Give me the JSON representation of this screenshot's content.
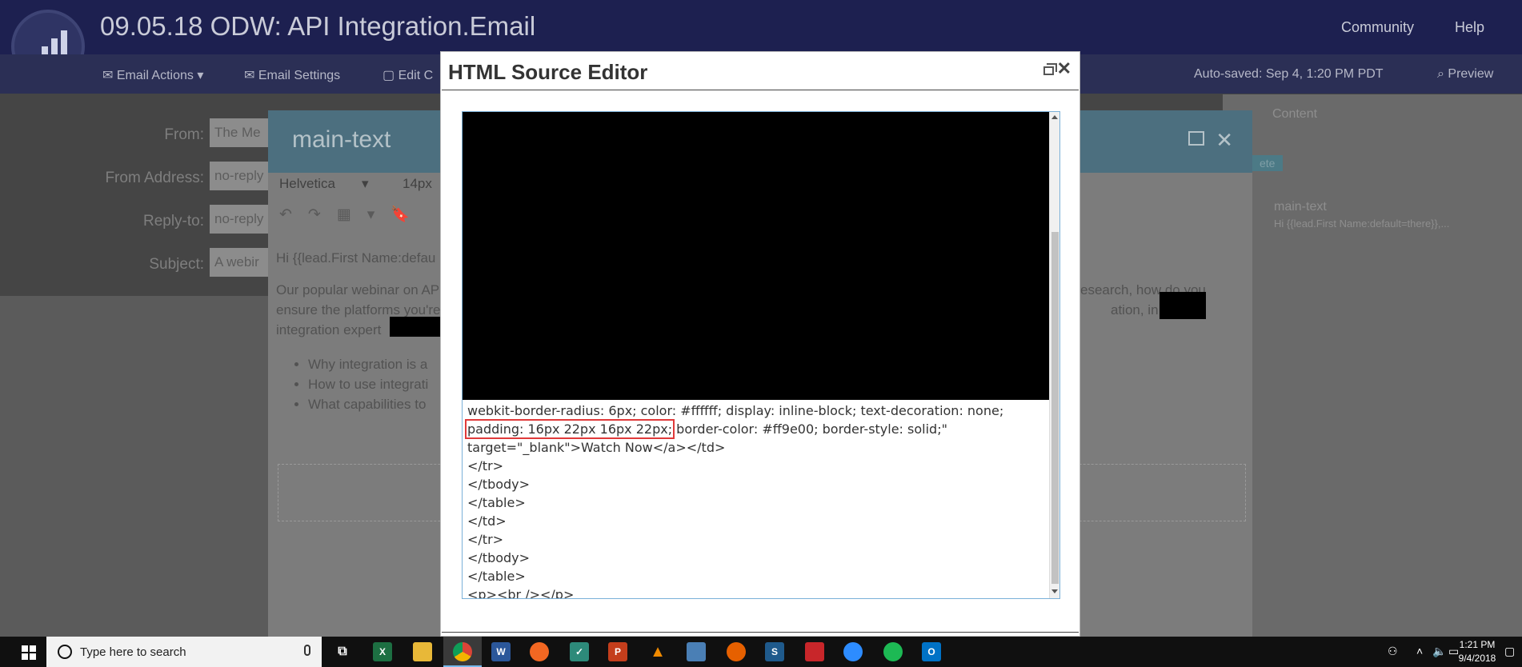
{
  "app": {
    "title": "09.05.18 ODW: API Integration.Email",
    "header_links": [
      "Community",
      "Help"
    ]
  },
  "toolbar": {
    "email_actions": "Email Actions",
    "email_settings": "Email Settings",
    "edit": "Edit C",
    "autosave": "Auto-saved: Sep 4, 1:20 PM PDT",
    "preview": "Preview"
  },
  "form": {
    "rows": [
      {
        "label": "From:",
        "value": "The Me"
      },
      {
        "label": "From Address:",
        "value": "no-reply"
      },
      {
        "label": "Reply-to:",
        "value": "no-reply"
      },
      {
        "label": "Subject:",
        "value": "A webir"
      }
    ]
  },
  "right_pane": {
    "content_label": "Content",
    "tag": "ete",
    "item_title": "main-text",
    "item_sub": "Hi {{lead.First Name:default=there}},..."
  },
  "main_text_dialog": {
    "title": "main-text",
    "font": "Helvetica",
    "size": "14px",
    "greeting": "Hi {{lead.First Name:defau",
    "para_line1": "Our popular webinar on AP",
    "para_line1_right": "esearch, how do you",
    "para_line2": "ensure the platforms you're",
    "para_line2_right": "ation, in which",
    "para_line3": "integration expert",
    "bullets": [
      "Why integration is a",
      "How to use integrati",
      "What capabilities to"
    ]
  },
  "source_editor": {
    "title": "HTML Source Editor",
    "code": {
      "line1": "webkit-border-radius: 6px; color: #ffffff; display: inline-block; text-decoration: none;",
      "line2_highlight": "padding: 16px 22px 16px 22px;",
      "line2_rest": " border-color: #ff9e00; border-style: solid;\"",
      "line3": "target=\"_blank\">Watch Now</a></td>",
      "rest": [
        "</tr>",
        "</tbody>",
        "</table>",
        "</td>",
        "</tr>",
        "</tbody>",
        "</table>",
        "<p><br /></p>"
      ]
    }
  },
  "taskbar": {
    "search_placeholder": "Type here to search",
    "time": "1:21 PM",
    "date": "9/4/2018",
    "apps": [
      "task-view",
      "excel",
      "file-explorer",
      "chrome",
      "word",
      "app-orange",
      "defender",
      "powerpoint",
      "vlc",
      "network-app",
      "firefox",
      "snagit",
      "app-red",
      "zoom",
      "spotify",
      "outlook"
    ]
  },
  "colors": {
    "source_highlight": "#e03a3a",
    "textarea_border": "#7ab0d8",
    "header_navy": "#1d2050",
    "dialog_teal": "#4c6f7f"
  }
}
